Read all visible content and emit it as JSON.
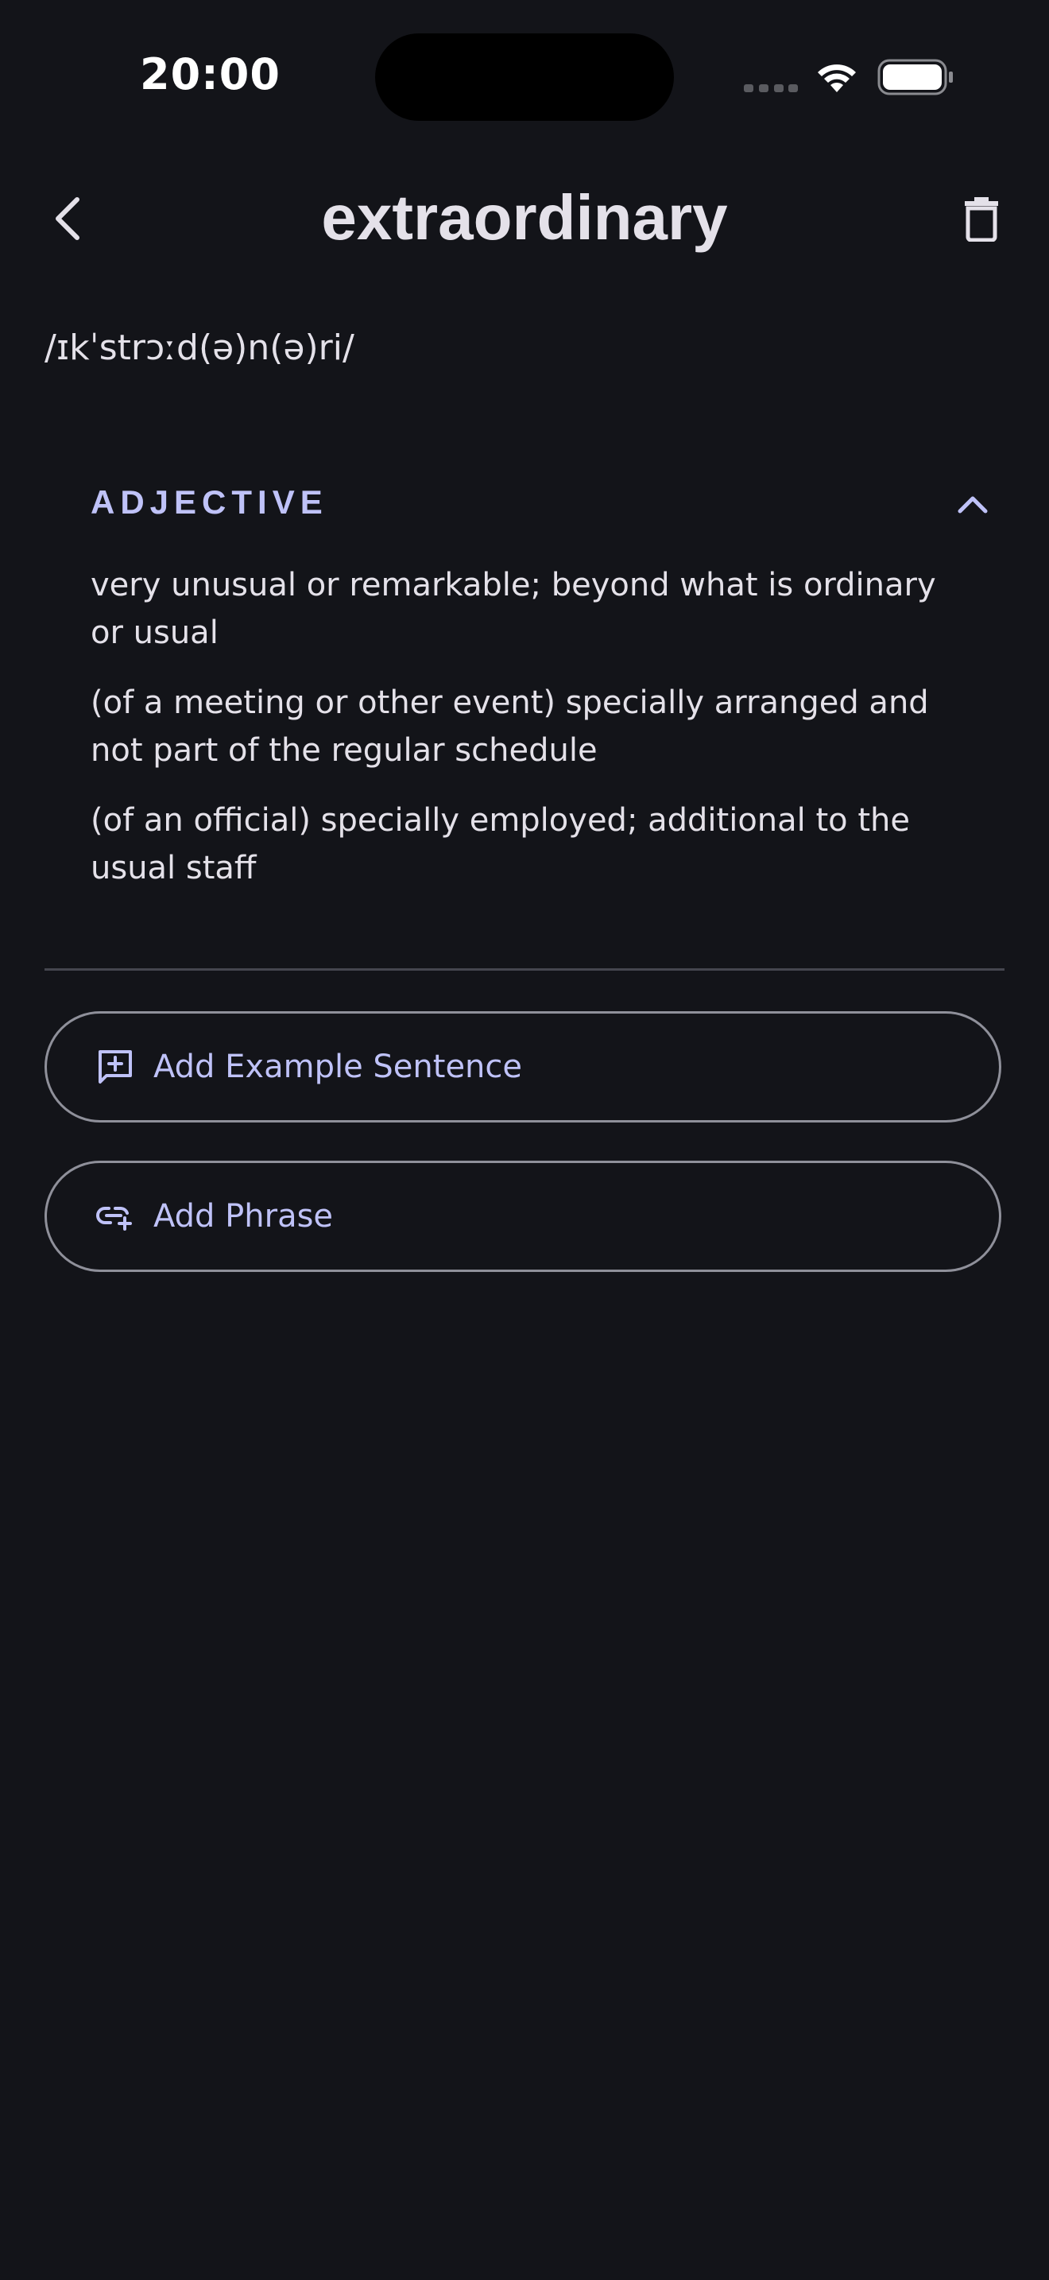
{
  "status_bar": {
    "time": "20:00"
  },
  "header": {
    "title": "extraordinary",
    "back_icon": "chevron-left-icon",
    "delete_icon": "trash-icon"
  },
  "word": {
    "pronunciation": "/ɪkˈstrɔːd(ə)n(ə)ri/"
  },
  "meanings": [
    {
      "part_of_speech": "ADJECTIVE",
      "expanded": true,
      "definitions": [
        "very unusual or remarkable; beyond what is ordinary or usual",
        "(of a meeting or other event) specially arranged and not part of the regular schedule",
        "(of an official) specially employed; additional to the usual staff"
      ]
    }
  ],
  "actions": {
    "add_example_label": "Add Example Sentence",
    "add_phrase_label": "Add Phrase"
  },
  "colors": {
    "background": "#131419",
    "on_surface": "#e4e1e9",
    "primary": "#bfc2f8",
    "outline": "#8f909a"
  }
}
